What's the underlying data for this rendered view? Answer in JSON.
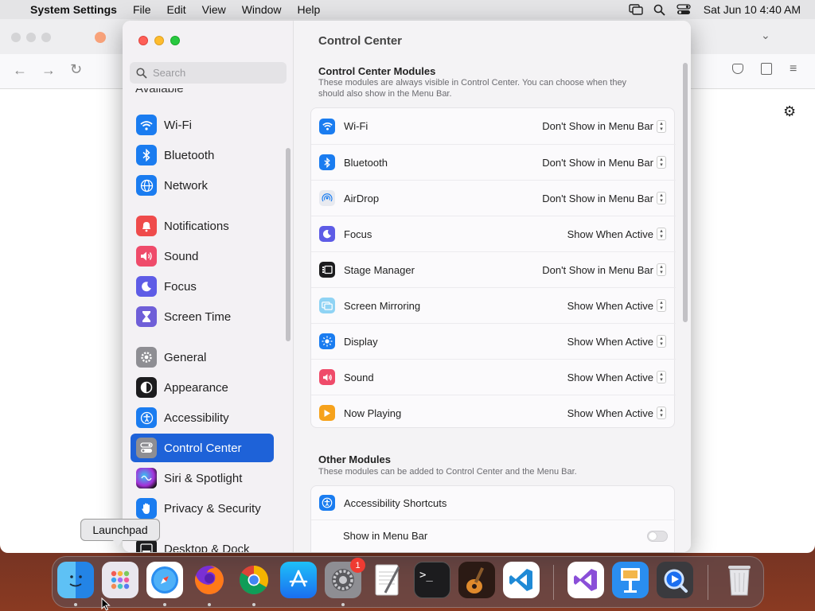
{
  "menubar": {
    "apple": "",
    "app": "System Settings",
    "items": [
      "File",
      "Edit",
      "View",
      "Window",
      "Help"
    ],
    "clock": "Sat Jun 10  4:40 AM"
  },
  "search": {
    "placeholder": "Search"
  },
  "sidebar": {
    "partial_heading": "Available",
    "items": [
      {
        "label": "Wi-Fi",
        "icon": "wifi-icon",
        "color": "#1a7cf0"
      },
      {
        "label": "Bluetooth",
        "icon": "bluetooth-icon",
        "color": "#1a7cf0"
      },
      {
        "label": "Network",
        "icon": "globe-icon",
        "color": "#1a7cf0"
      },
      {
        "label": "Notifications",
        "icon": "bell-icon",
        "color": "#ef4b4b"
      },
      {
        "label": "Sound",
        "icon": "speaker-icon",
        "color": "#ef4b6a"
      },
      {
        "label": "Focus",
        "icon": "moon-icon",
        "color": "#5e5ce6"
      },
      {
        "label": "Screen Time",
        "icon": "hourglass-icon",
        "color": "#6f5fd8"
      },
      {
        "label": "General",
        "icon": "gear-icon",
        "color": "#8e8e93"
      },
      {
        "label": "Appearance",
        "icon": "appearance-icon",
        "color": "#1c1c1e"
      },
      {
        "label": "Accessibility",
        "icon": "accessibility-icon",
        "color": "#1a7cf0"
      },
      {
        "label": "Control Center",
        "icon": "control-center-icon",
        "color": "#8e8e93"
      },
      {
        "label": "Siri & Spotlight",
        "icon": "siri-icon",
        "color": "#c02bd0"
      },
      {
        "label": "Privacy & Security",
        "icon": "hand-icon",
        "color": "#1a7cf0"
      },
      {
        "label": "Desktop & Dock",
        "icon": "dock-icon",
        "color": "#1c1c1e"
      }
    ]
  },
  "main": {
    "title": "Control Center",
    "modules_heading": "Control Center Modules",
    "modules_desc": "These modules are always visible in Control Center. You can choose when they should also show in the Menu Bar.",
    "modules": [
      {
        "label": "Wi-Fi",
        "value": "Don't Show in Menu Bar",
        "icon": "wifi-icon",
        "color": "#1a7cf0"
      },
      {
        "label": "Bluetooth",
        "value": "Don't Show in Menu Bar",
        "icon": "bluetooth-icon",
        "color": "#1a7cf0"
      },
      {
        "label": "AirDrop",
        "value": "Don't Show in Menu Bar",
        "icon": "airdrop-icon",
        "color": "#e8eaf0"
      },
      {
        "label": "Focus",
        "value": "Show When Active",
        "icon": "moon-icon",
        "color": "#5e5ce6"
      },
      {
        "label": "Stage Manager",
        "value": "Don't Show in Menu Bar",
        "icon": "stage-manager-icon",
        "color": "#1c1c1e"
      },
      {
        "label": "Screen Mirroring",
        "value": "Show When Active",
        "icon": "screen-mirroring-icon",
        "color": "#8fd3f4"
      },
      {
        "label": "Display",
        "value": "Show When Active",
        "icon": "sun-icon",
        "color": "#1a7cf0"
      },
      {
        "label": "Sound",
        "value": "Show When Active",
        "icon": "speaker-icon",
        "color": "#ef4b6a"
      },
      {
        "label": "Now Playing",
        "value": "Show When Active",
        "icon": "play-icon",
        "color": "#f6a21c"
      }
    ],
    "other_heading": "Other Modules",
    "other_desc": "These modules can be added to Control Center and the Menu Bar.",
    "other": [
      {
        "label": "Accessibility Shortcuts",
        "icon": "accessibility-icon",
        "color": "#1a7cf0"
      }
    ],
    "toggle_label": "Show in Menu Bar",
    "toggle_on": false
  },
  "tooltip": "Launchpad",
  "dock": {
    "items": [
      {
        "name": "finder",
        "running": true
      },
      {
        "name": "launchpad",
        "running": false
      },
      {
        "name": "safari",
        "running": true
      },
      {
        "name": "firefox",
        "running": true
      },
      {
        "name": "chrome",
        "running": true
      },
      {
        "name": "app-store",
        "running": false
      },
      {
        "name": "system-settings",
        "running": true,
        "badge": "1"
      },
      {
        "name": "textedit",
        "running": false
      },
      {
        "name": "terminal",
        "running": false
      },
      {
        "name": "garageband",
        "running": false
      },
      {
        "name": "vscode",
        "running": false
      },
      {
        "name": "visual-studio",
        "running": false
      },
      {
        "name": "keynote",
        "running": false
      },
      {
        "name": "quicktime",
        "running": false
      },
      {
        "name": "trash",
        "running": false
      }
    ]
  }
}
